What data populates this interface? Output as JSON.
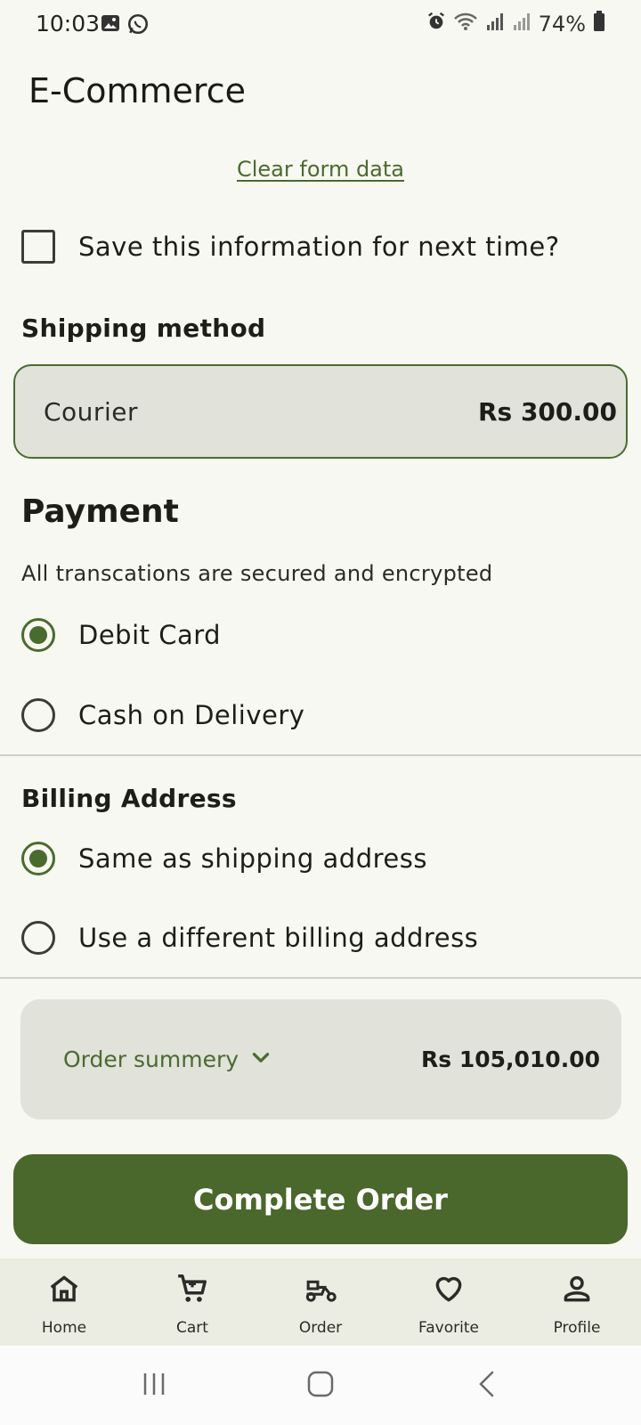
{
  "status_bar": {
    "time": "10:03",
    "battery": "74%",
    "icons": [
      "gallery-icon",
      "whatsapp-icon",
      "alarm-icon",
      "wifi-icon",
      "signal-icon",
      "signal-icon",
      "battery-icon"
    ]
  },
  "header": {
    "title": "E-Commerce"
  },
  "form": {
    "clear_link": "Clear form data",
    "save_info_label": "Save this information for next time?",
    "save_info_checked": false
  },
  "shipping": {
    "title": "Shipping method",
    "method": "Courier",
    "price": "Rs 300.00"
  },
  "payment": {
    "title": "Payment",
    "subtitle": "All transcations are secured and encrypted",
    "options": [
      {
        "label": "Debit Card",
        "selected": true
      },
      {
        "label": "Cash on Delivery",
        "selected": false
      }
    ]
  },
  "billing": {
    "title": "Billing Address",
    "options": [
      {
        "label": "Same as shipping address",
        "selected": true
      },
      {
        "label": "Use a different billing address",
        "selected": false
      }
    ]
  },
  "summary": {
    "label": "Order summery",
    "total": "Rs 105,010.00"
  },
  "actions": {
    "complete_label": "Complete Order"
  },
  "bottom_nav": {
    "items": [
      {
        "label": "Home",
        "icon": "home-icon"
      },
      {
        "label": "Cart",
        "icon": "cart-icon"
      },
      {
        "label": "Order",
        "icon": "order-icon"
      },
      {
        "label": "Favorite",
        "icon": "heart-icon"
      },
      {
        "label": "Profile",
        "icon": "profile-icon"
      }
    ]
  },
  "colors": {
    "accent": "#4a672c",
    "background": "#f7f8f1",
    "surface": "#e1e2da",
    "nav_background": "#ebece2"
  }
}
